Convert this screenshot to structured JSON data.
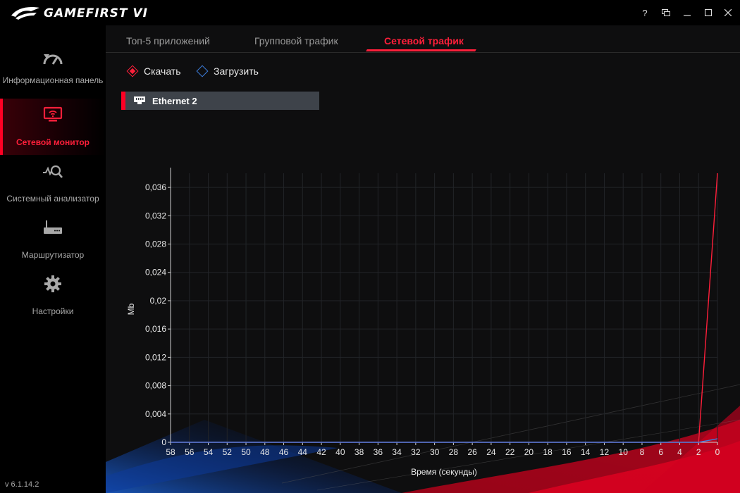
{
  "app": {
    "title": "GAMEFIRST VI",
    "version": "v 6.1.14.2",
    "window_controls": [
      "help-icon",
      "restore-window-icon",
      "minimize-icon",
      "maximize-icon",
      "close-icon"
    ],
    "help_symbol": "?"
  },
  "sidebar": {
    "items": [
      {
        "label": "Информационная панель",
        "icon": "speedometer-icon",
        "active": false
      },
      {
        "label": "Сетевой монитор",
        "icon": "monitor-wifi-icon",
        "active": true
      },
      {
        "label": "Системный анализатор",
        "icon": "analyzer-icon",
        "active": false
      },
      {
        "label": "Маршрутизатор",
        "icon": "router-icon",
        "active": false
      },
      {
        "label": "Настройки",
        "icon": "gear-icon",
        "active": false
      }
    ]
  },
  "tabs": [
    {
      "label": "Топ-5 приложений",
      "active": false
    },
    {
      "label": "Групповой трафик",
      "active": false
    },
    {
      "label": "Сетевой трафик",
      "active": true
    }
  ],
  "legend": {
    "download": {
      "label": "Скачать",
      "color": "#ff1f3a"
    },
    "upload": {
      "label": "Загрузить",
      "color": "#3d7fe0"
    }
  },
  "adapter": {
    "name": "Ethernet 2"
  },
  "colors": {
    "accent": "#ff0024",
    "background": "#0e0e0f",
    "sidebar": "#000000"
  },
  "chart_data": {
    "type": "line",
    "xlabel": "Время (секунды)",
    "ylabel": "Mb",
    "x": [
      58,
      56,
      54,
      52,
      50,
      48,
      46,
      44,
      42,
      40,
      38,
      36,
      34,
      32,
      30,
      28,
      26,
      24,
      22,
      20,
      18,
      16,
      14,
      12,
      10,
      8,
      6,
      4,
      2,
      0
    ],
    "x_tick_labels": [
      "58",
      "56",
      "54",
      "52",
      "50",
      "48",
      "46",
      "44",
      "42",
      "40",
      "38",
      "36",
      "34",
      "32",
      "30",
      "28",
      "26",
      "24",
      "22",
      "20",
      "18",
      "16",
      "14",
      "12",
      "10",
      "8",
      "6",
      "4",
      "2",
      "0"
    ],
    "ylim": [
      0,
      0.038
    ],
    "y_tick_labels": [
      "0",
      "0,004",
      "0,008",
      "0,012",
      "0,016",
      "0,02",
      "0,024",
      "0,028",
      "0,032",
      "0,036"
    ],
    "y_ticks": [
      0,
      0.004,
      0.008,
      0.012,
      0.016,
      0.02,
      0.024,
      0.028,
      0.032,
      0.036
    ],
    "grid": true,
    "series": [
      {
        "name": "Скачать",
        "color": "#ff1f3a",
        "values": [
          0,
          0,
          0,
          0,
          0,
          0,
          0,
          0,
          0,
          0,
          0,
          0,
          0,
          0,
          0,
          0,
          0,
          0,
          0,
          0,
          0,
          0,
          0,
          0,
          0,
          0,
          0,
          0,
          0,
          0.038
        ]
      },
      {
        "name": "Загрузить",
        "color": "#3d7fe0",
        "values": [
          0,
          0,
          0,
          0,
          0,
          0,
          0,
          0,
          0,
          0,
          0,
          0,
          0,
          0,
          0,
          0,
          0,
          0,
          0,
          0,
          0,
          0,
          0,
          0,
          0,
          0,
          0,
          0,
          0,
          0.0005
        ]
      }
    ]
  }
}
